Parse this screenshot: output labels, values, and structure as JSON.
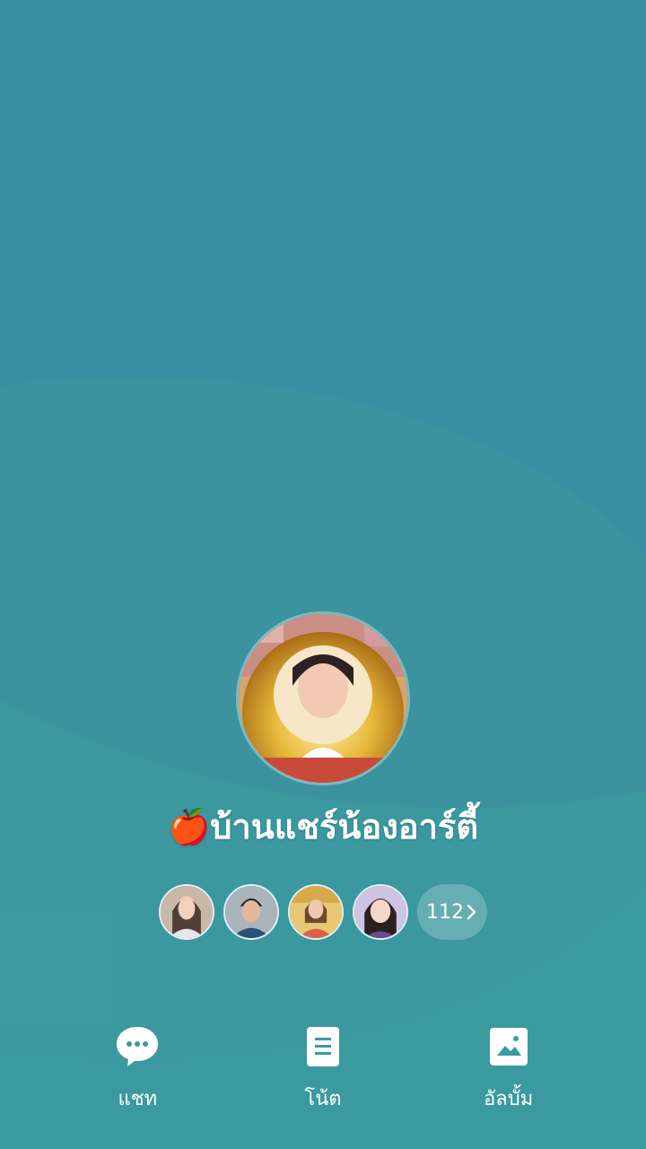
{
  "group": {
    "title": "🍎บ้านแชร์น้องอาร์ตี้",
    "member_count_label": "112",
    "colors": {
      "background": "#3b9aa0",
      "text": "#ffffff"
    }
  },
  "actions": [
    {
      "label": "แชท",
      "icon": "chat-bubble-icon"
    },
    {
      "label": "โน้ต",
      "icon": "note-icon"
    },
    {
      "label": "อัลบั้ม",
      "icon": "album-icon"
    }
  ]
}
